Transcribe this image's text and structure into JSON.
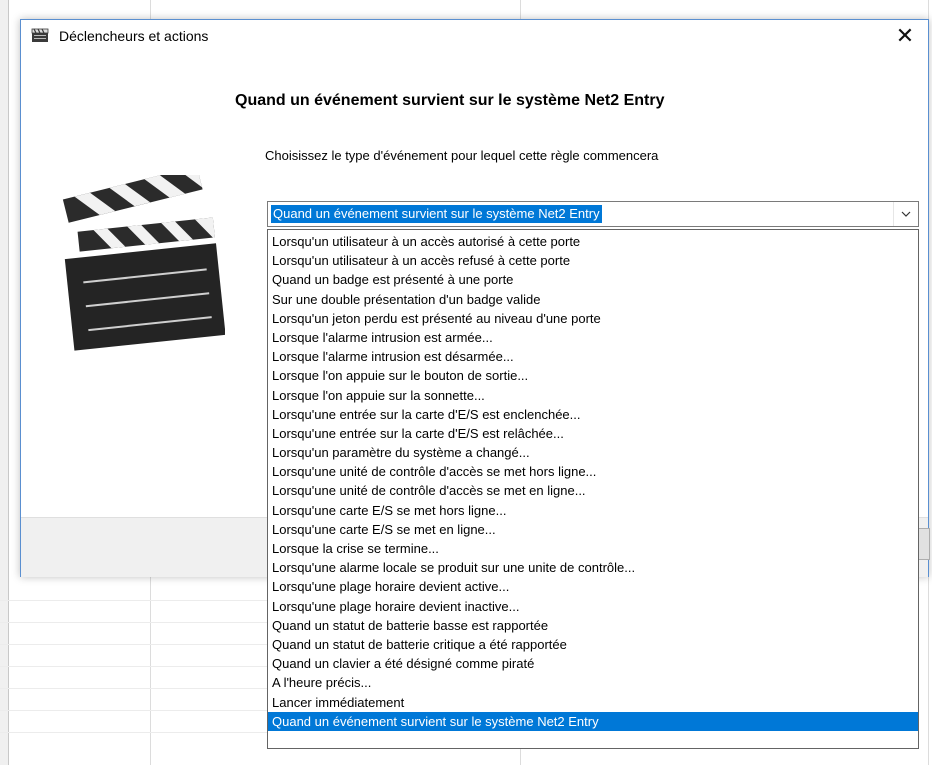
{
  "window": {
    "title": "Déclencheurs et actions",
    "close_glyph": "✕"
  },
  "heading": "Quand un événement survient sur le système Net2 Entry",
  "instruction": "Choisissez le type d'événement pour lequel cette règle commencera",
  "combo": {
    "selected": "Quand un événement survient sur le système Net2 Entry",
    "arrow_icon": "chevron-down-icon"
  },
  "options": [
    "Lorsqu'un utilisateur à un accès autorisé à cette porte",
    "Lorsqu'un utilisateur à un accès refusé à cette porte",
    "Quand un badge est présenté à une porte",
    "Sur une double présentation d'un badge valide",
    "Lorsqu'un jeton perdu est présenté au niveau d'une porte",
    "Lorsque l'alarme intrusion est armée...",
    "Lorsque l'alarme intrusion est désarmée...",
    "Lorsque l'on appuie sur le bouton de sortie...",
    "Lorsque l'on appuie sur la sonnette...",
    "Lorsqu'une entrée sur la carte d'E/S est enclenchée...",
    "Lorsqu'une entrée sur la carte d'E/S est relâchée...",
    "Lorsqu'un paramètre du système a changé...",
    "Lorsqu'une unité de contrôle d'accès se met hors ligne...",
    "Lorsqu'une unité de contrôle d'accès se met en ligne...",
    "Lorsqu'une carte E/S se met hors ligne...",
    "Lorsqu'une carte E/S se met en ligne...",
    "Lorsque la crise se termine...",
    "Lorsqu'une alarme locale se produit sur une unite de contrôle...",
    "Lorsqu'une plage horaire devient active...",
    "Lorsqu'une plage horaire devient inactive...",
    "Quand un statut de batterie basse est rapportée",
    "Quand un statut de batterie critique a été rapportée",
    "Quand un clavier a été désigné comme piraté",
    "A l'heure précis...",
    "Lancer immédiatement",
    "Quand un événement survient sur le système Net2 Entry"
  ],
  "selected_index": 25,
  "colors": {
    "selection": "#0078d7",
    "dialog_border": "#5a8fd0"
  }
}
